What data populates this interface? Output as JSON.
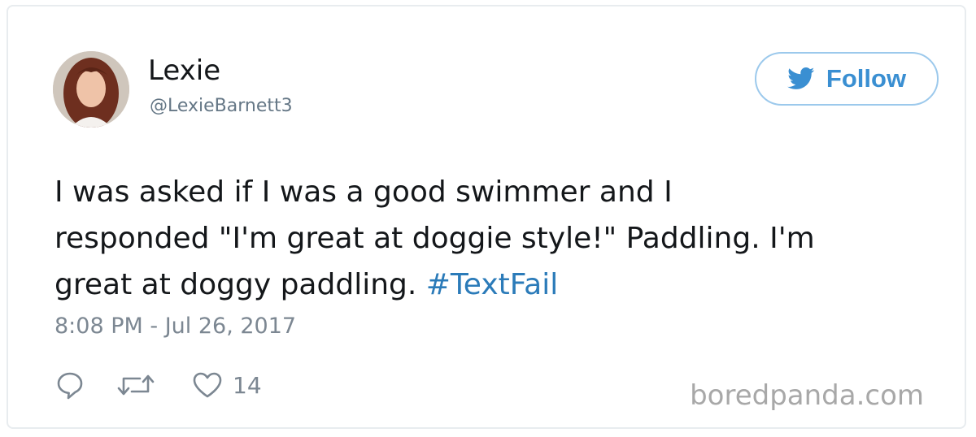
{
  "tweet": {
    "author_name": "Lexie",
    "author_handle": "@LexieBarnett3",
    "follow_label": "Follow",
    "text_line1": "I was asked if I was a good swimmer and I",
    "text_line2": "responded \"I'm great at doggie style!\" Paddling. I'm",
    "text_line3": "great at doggy paddling.",
    "hashtag": "#TextFail",
    "timestamp": "8:08 PM - Jul 26, 2017",
    "like_count": "14"
  },
  "icons": {
    "follow": "twitter-bird-icon",
    "reply": "reply-icon",
    "retweet": "retweet-icon",
    "like": "heart-icon"
  },
  "watermark": "boredpanda.com",
  "colors": {
    "link": "#2b7bb9",
    "follow_border": "#9cc9ec",
    "follow_text": "#3a8fd2",
    "muted": "#7c8792"
  }
}
